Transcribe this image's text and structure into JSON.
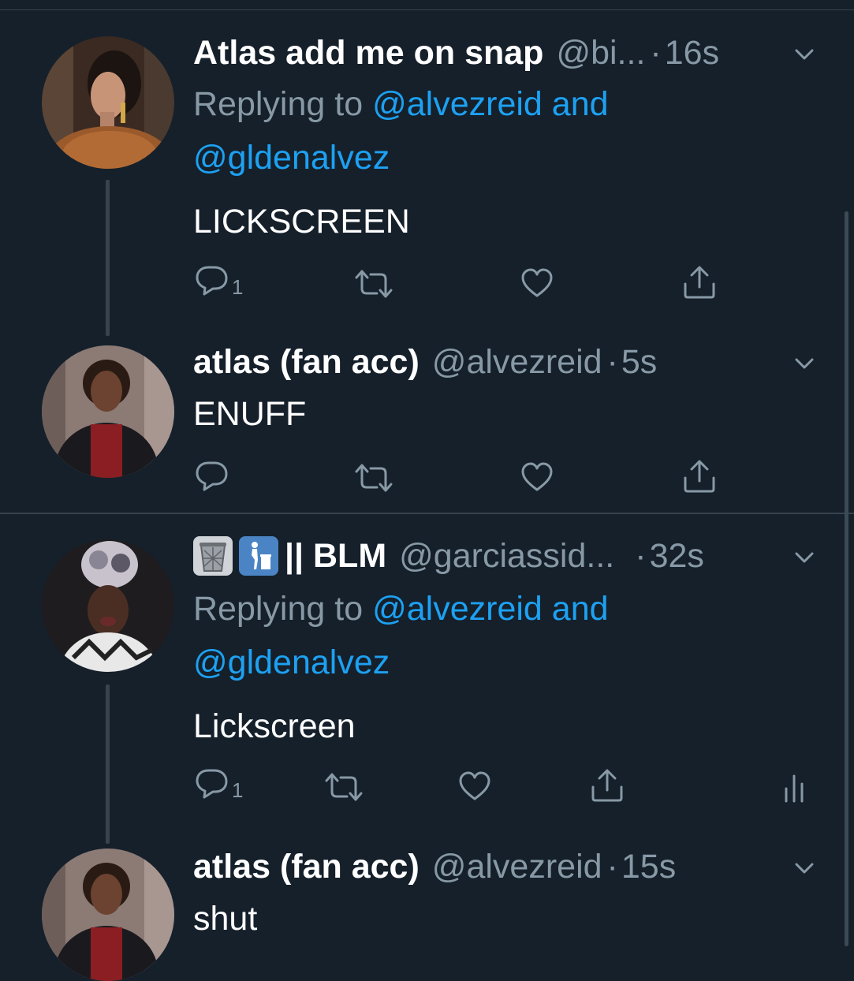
{
  "tweets": [
    {
      "display_name": "Atlas add me on snap",
      "handle": "@bi...",
      "time": "16s",
      "replying_prefix": "Replying to",
      "replying_mentions_line1": "@alvezreid and",
      "replying_mentions_line2": "@gldenalvez",
      "text": "LICKSCREEN",
      "reply_count": "1"
    },
    {
      "display_name": "atlas (fan acc)",
      "handle": "@alvezreid",
      "time": "5s",
      "text": "ENUFF"
    },
    {
      "display_name": "|| BLM",
      "handle": "@garciassid...",
      "time": "32s",
      "replying_prefix": "Replying to",
      "replying_mentions_line1": "@alvezreid and",
      "replying_mentions_line2": "@gldenalvez",
      "text": "Lickscreen",
      "reply_count": "1",
      "name_emoji": [
        "wastebasket-icon",
        "put-litter-in-its-place-icon"
      ]
    },
    {
      "display_name": "atlas (fan acc)",
      "handle": "@alvezreid",
      "time": "15s",
      "text": "shut"
    }
  ],
  "separator": "·",
  "colors": {
    "background": "#15202b",
    "text_primary": "#ffffff",
    "text_secondary": "#8899a6",
    "accent": "#1da1f2",
    "divider": "#38444d"
  }
}
